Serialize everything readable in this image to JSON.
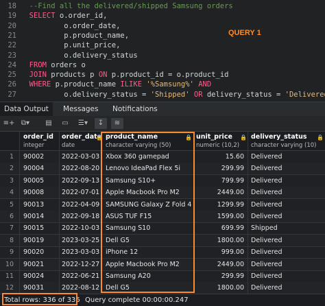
{
  "editor": {
    "lines": [
      {
        "n": "18",
        "parts": [
          {
            "t": "  --Find all the delivered/shipped Samsung orders",
            "c": "cm"
          }
        ]
      },
      {
        "n": "19",
        "parts": [
          {
            "t": "  SELECT ",
            "c": "kw"
          },
          {
            "t": "o.order_id,",
            "c": ""
          }
        ]
      },
      {
        "n": "20",
        "parts": [
          {
            "t": "          o.order_date,",
            "c": ""
          }
        ]
      },
      {
        "n": "21",
        "parts": [
          {
            "t": "          p.product_name,",
            "c": ""
          }
        ]
      },
      {
        "n": "22",
        "parts": [
          {
            "t": "          p.unit_price,",
            "c": ""
          }
        ]
      },
      {
        "n": "23",
        "parts": [
          {
            "t": "          o.delivery_status",
            "c": ""
          }
        ]
      },
      {
        "n": "24",
        "parts": [
          {
            "t": "  FROM ",
            "c": "kw"
          },
          {
            "t": "orders o",
            "c": ""
          }
        ]
      },
      {
        "n": "25",
        "parts": [
          {
            "t": "  JOIN ",
            "c": "kw"
          },
          {
            "t": "products p ",
            "c": ""
          },
          {
            "t": "ON ",
            "c": "kw"
          },
          {
            "t": "p.product_id = o.product_id",
            "c": ""
          }
        ]
      },
      {
        "n": "26",
        "parts": [
          {
            "t": "  WHERE ",
            "c": "kw"
          },
          {
            "t": "p.product_name ",
            "c": ""
          },
          {
            "t": "ILIKE ",
            "c": "kw"
          },
          {
            "t": "'%Samsung%' ",
            "c": "str"
          },
          {
            "t": "AND",
            "c": "kw"
          }
        ]
      },
      {
        "n": "27",
        "parts": [
          {
            "t": "          o.delivery_status = ",
            "c": ""
          },
          {
            "t": "'Shipped' ",
            "c": "str"
          },
          {
            "t": "OR ",
            "c": "kw"
          },
          {
            "t": "delivery_status = ",
            "c": ""
          },
          {
            "t": "'Delivered'",
            "c": "str"
          },
          {
            "t": ";",
            "c": ""
          }
        ]
      }
    ],
    "annotation": "QUERY 1"
  },
  "tabs": [
    "Data Output",
    "Messages",
    "Notifications"
  ],
  "columns": [
    {
      "name": "order_id",
      "type": "integer"
    },
    {
      "name": "order_date",
      "type": "date"
    },
    {
      "name": "product_name",
      "type": "character varying (50)"
    },
    {
      "name": "unit_price",
      "type": "numeric (10,2)"
    },
    {
      "name": "delivery_status",
      "type": "character varying (10)"
    }
  ],
  "rows": [
    [
      "1",
      "90002",
      "2022-03-03",
      "Xbox 360 gamepad",
      "15.60",
      "Delivered"
    ],
    [
      "2",
      "90004",
      "2022-08-20",
      "Lenovo IdeaPad Flex 5i",
      "299.99",
      "Delivered"
    ],
    [
      "3",
      "90005",
      "2022-09-13",
      "Samsung S10+",
      "799.99",
      "Delivered"
    ],
    [
      "4",
      "90008",
      "2022-07-01",
      "Apple Macbook Pro M2",
      "2449.00",
      "Delivered"
    ],
    [
      "5",
      "90013",
      "2022-04-09",
      "SAMSUNG Galaxy Z Fold 4",
      "1299.99",
      "Delivered"
    ],
    [
      "6",
      "90014",
      "2022-09-18",
      "ASUS TUF F15",
      "1599.00",
      "Delivered"
    ],
    [
      "7",
      "90015",
      "2022-10-03",
      "Samsung S10",
      "699.99",
      "Shipped"
    ],
    [
      "8",
      "90019",
      "2023-03-25",
      "Dell G5",
      "1800.00",
      "Delivered"
    ],
    [
      "9",
      "90020",
      "2023-03-03",
      "iPhone 12",
      "999.00",
      "Delivered"
    ],
    [
      "10",
      "90021",
      "2022-12-27",
      "Apple Macbook Pro M2",
      "2449.00",
      "Delivered"
    ],
    [
      "11",
      "90024",
      "2022-06-21",
      "Samsung A20",
      "299.99",
      "Delivered"
    ],
    [
      "12",
      "90031",
      "2022-08-12",
      "Dell G5",
      "1800.00",
      "Delivered"
    ]
  ],
  "status": {
    "total_rows": "Total rows: 336 of 336",
    "query_complete": "Query complete 00:00:00.247"
  },
  "toolbar_icons": [
    "add-row-icon",
    "copy-icon",
    "paste-icon",
    "delete-icon",
    "save-data-icon",
    "filter-icon",
    "download-icon",
    "graph-icon"
  ],
  "colors": {
    "keyword": "#ff5c8a",
    "comment": "#6a9955",
    "string": "#e6b87a",
    "highlight": "#ff8c2a"
  }
}
